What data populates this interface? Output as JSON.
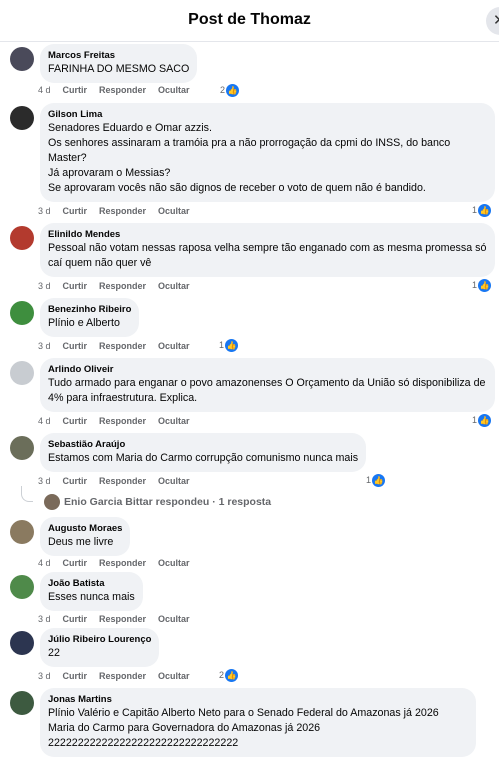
{
  "header": {
    "title": "Post de Thomaz",
    "close_icon": "close-icon"
  },
  "actions": {
    "like": "Curtir",
    "reply": "Responder",
    "hide": "Ocultar"
  },
  "comments": [
    {
      "author": "Marcos Freitas",
      "text": "FARINHA DO MESMO SACO",
      "time": "4 d",
      "likes": "2",
      "avatar_color": "#4a4a5a"
    },
    {
      "author": "Gilson Lima",
      "text": "Senadores Eduardo e Omar azzis.\nOs senhores assinaram a tramóia pra a não prorrogação da cpmi do INSS, do banco Master?\nJá aprovaram o Messias?\nSe aprovaram vocês não são dignos de receber o voto de quem não é bandido.",
      "time": "3 d",
      "likes": "1",
      "avatar_color": "#2b2b2b"
    },
    {
      "author": "Elinildo Mendes",
      "text": "Pessoal não votam nessas raposa velha sempre tão enganado com as mesma promessa só caí quem não quer vê",
      "time": "3 d",
      "likes": "1",
      "avatar_color": "#b33a2e"
    },
    {
      "author": "Benezinho Ribeiro",
      "text": "Plínio e Alberto",
      "time": "3 d",
      "likes": "1",
      "avatar_color": "#3e8e3e"
    },
    {
      "author": "Arlindo Oliveir",
      "text": "Tudo armado para enganar o povo amazonenses O Orçamento da União só disponibiliza de 4% para infraestrutura. Explica.",
      "time": "4 d",
      "likes": "1",
      "avatar_color": "#c8ccd1"
    },
    {
      "author": "Sebastião Araújo",
      "text": "Estamos com Maria do Carmo corrupção comunismo nunca mais",
      "time": "3 d",
      "likes": "1",
      "avatar_color": "#6b6e5a",
      "reply_summary": "Enio Garcia Bittar respondeu · 1 resposta"
    },
    {
      "author": "Augusto Moraes",
      "text": "Deus me livre",
      "time": "4 d",
      "likes": "",
      "avatar_color": "#8a7a60"
    },
    {
      "author": "João Batista",
      "text": "Esses nunca mais",
      "time": "3 d",
      "likes": "",
      "avatar_color": "#4f8a4a"
    },
    {
      "author": "Júlio Ribeiro Lourenço",
      "text": "22",
      "time": "3 d",
      "likes": "2",
      "avatar_color": "#2c3550"
    },
    {
      "author": "Jonas Martins",
      "text": "Plínio Valério e Capitão Alberto Neto para o Senado Federal do Amazonas já 2026\nMaria do Carmo para Governadora do Amazonas já 2026\n22222222222222222222222222222222",
      "time": "",
      "likes": "",
      "avatar_color": "#3d5a40"
    }
  ]
}
